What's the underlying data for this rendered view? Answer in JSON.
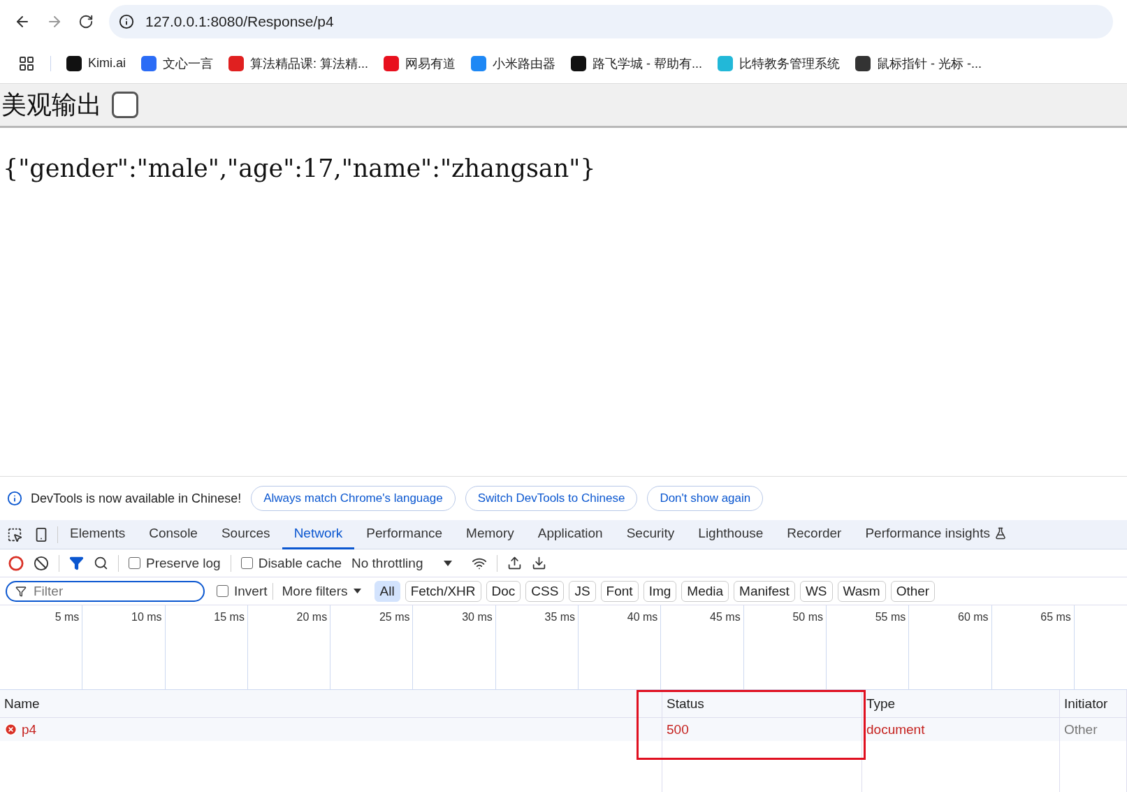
{
  "browser": {
    "url": "127.0.0.1:8080/Response/p4",
    "bookmarks": [
      {
        "label": "Kimi.ai",
        "color": "#111111"
      },
      {
        "label": "文心一言",
        "color": "#2b6cf6"
      },
      {
        "label": "算法精品课: 算法精...",
        "color": "#e02020"
      },
      {
        "label": "网易有道",
        "color": "#e8101e"
      },
      {
        "label": "小米路由器",
        "color": "#1e88f5"
      },
      {
        "label": "路飞学城 - 帮助有...",
        "color": "#111111"
      },
      {
        "label": "比特教务管理系统",
        "color": "#22b8d8"
      },
      {
        "label": "鼠标指针 - 光标 -...",
        "color": "#333333"
      }
    ]
  },
  "page": {
    "pretty_label": "美观输出",
    "pretty_checked": false,
    "body": "{\"gender\":\"male\",\"age\":17,\"name\":\"zhangsan\"}"
  },
  "devtools": {
    "infobar": {
      "message": "DevTools is now available in Chinese!",
      "buttons": [
        "Always match Chrome's language",
        "Switch DevTools to Chinese",
        "Don't show again"
      ]
    },
    "tabs": [
      {
        "label": "Elements",
        "selected": false
      },
      {
        "label": "Console",
        "selected": false
      },
      {
        "label": "Sources",
        "selected": false
      },
      {
        "label": "Network",
        "selected": true
      },
      {
        "label": "Performance",
        "selected": false
      },
      {
        "label": "Memory",
        "selected": false
      },
      {
        "label": "Application",
        "selected": false
      },
      {
        "label": "Security",
        "selected": false
      },
      {
        "label": "Lighthouse",
        "selected": false
      },
      {
        "label": "Recorder",
        "selected": false
      },
      {
        "label": "Performance insights",
        "selected": false
      }
    ],
    "toolbar": {
      "preserve_log": {
        "label": "Preserve log",
        "checked": false
      },
      "disable_cache": {
        "label": "Disable cache",
        "checked": false
      },
      "throttling": "No throttling"
    },
    "filter": {
      "placeholder": "Filter",
      "invert": {
        "label": "Invert",
        "checked": false
      },
      "more_filters": "More filters",
      "types": [
        {
          "label": "All",
          "selected": true
        },
        {
          "label": "Fetch/XHR",
          "selected": false
        },
        {
          "label": "Doc",
          "selected": false
        },
        {
          "label": "CSS",
          "selected": false
        },
        {
          "label": "JS",
          "selected": false
        },
        {
          "label": "Font",
          "selected": false
        },
        {
          "label": "Img",
          "selected": false
        },
        {
          "label": "Media",
          "selected": false
        },
        {
          "label": "Manifest",
          "selected": false
        },
        {
          "label": "WS",
          "selected": false
        },
        {
          "label": "Wasm",
          "selected": false
        },
        {
          "label": "Other",
          "selected": false
        }
      ]
    },
    "timeline_ticks": [
      "5 ms",
      "10 ms",
      "15 ms",
      "20 ms",
      "25 ms",
      "30 ms",
      "35 ms",
      "40 ms",
      "45 ms",
      "50 ms",
      "55 ms",
      "60 ms",
      "65 ms"
    ],
    "table": {
      "columns": [
        "Name",
        "Status",
        "Type",
        "Initiator"
      ],
      "rows": [
        {
          "error": true,
          "cells": [
            "p4",
            "500",
            "document",
            "Other"
          ]
        }
      ]
    },
    "annotation": {
      "highlight": true
    }
  }
}
